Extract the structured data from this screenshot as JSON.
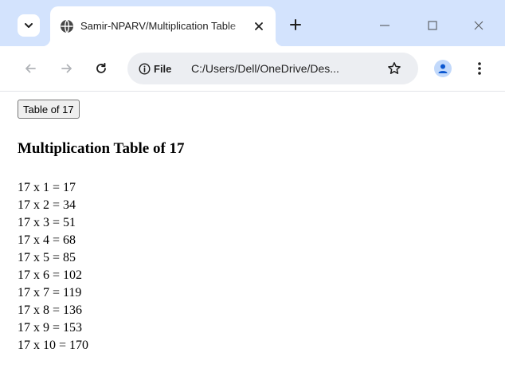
{
  "browser": {
    "tab": {
      "title": "Samir-NPARV/Multiplication Table"
    },
    "address_bar": {
      "scheme_label": "File",
      "url": "C:/Users/Dell/OneDrive/Des..."
    },
    "icons": {
      "tab_search": "chevron-down-icon",
      "favicon": "globe-icon",
      "tab_close": "close-icon",
      "new_tab": "plus-icon",
      "minimize": "minimize-icon",
      "maximize": "maximize-icon",
      "close_window": "close-icon",
      "back": "arrow-left-icon",
      "forward": "arrow-right-icon",
      "reload": "reload-icon",
      "site_info": "info-icon",
      "bookmark": "star-icon",
      "profile": "user-icon",
      "menu": "kebab-icon"
    },
    "colors": {
      "tabstrip": "#d3e3fd",
      "omnibox": "#eceef2",
      "profile": "#0b57d0"
    }
  },
  "page": {
    "button_label": "Table of 17",
    "heading": "Multiplication Table of 17",
    "results": [
      "17 x 1 = 17",
      "17 x 2 = 34",
      "17 x 3 = 51",
      "17 x 4 = 68",
      "17 x 5 = 85",
      "17 x 6 = 102",
      "17 x 7 = 119",
      "17 x 8 = 136",
      "17 x 9 = 153",
      "17 x 10 = 170"
    ]
  }
}
